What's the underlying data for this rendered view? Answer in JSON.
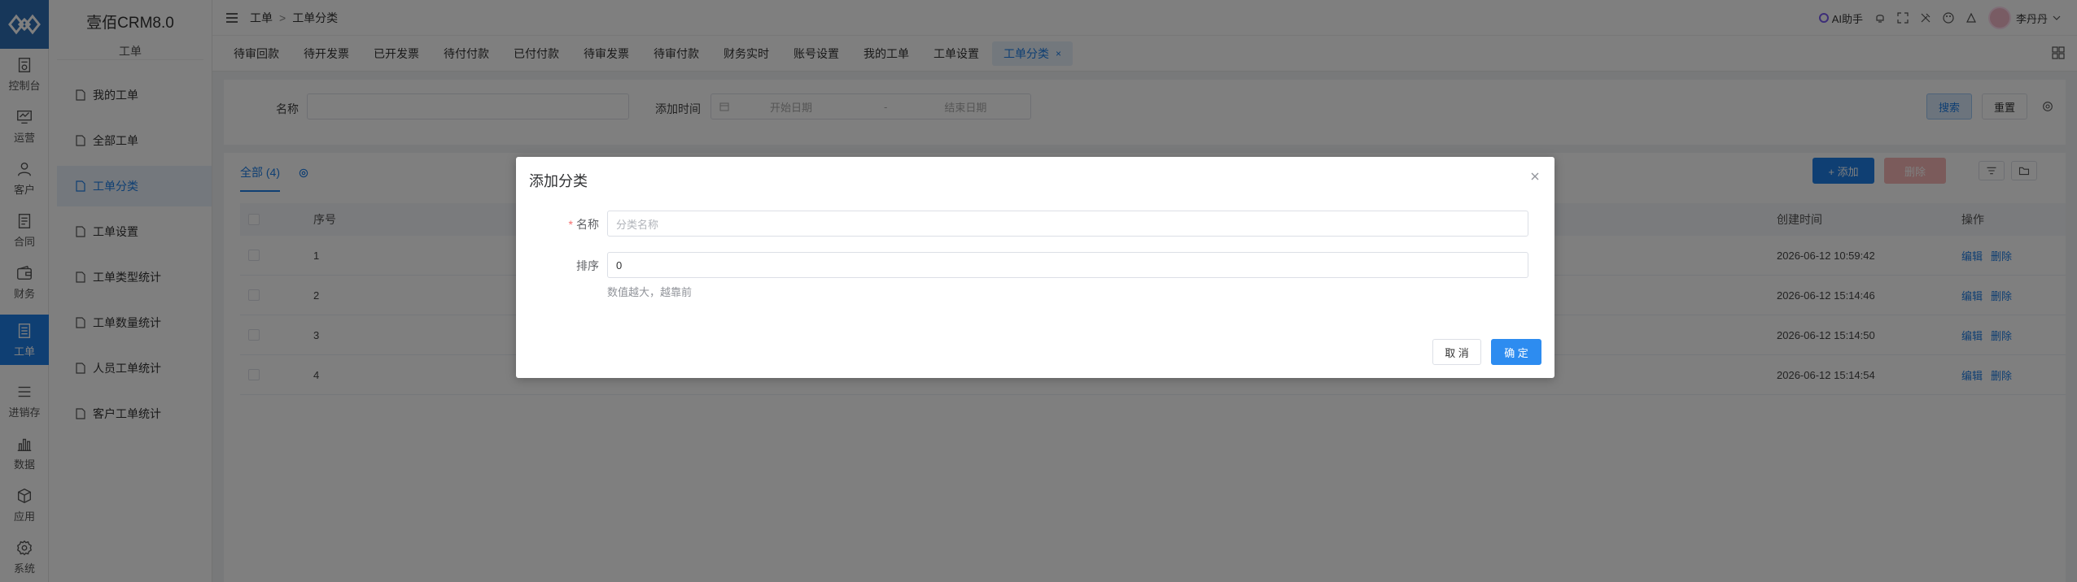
{
  "app": {
    "title": "壹佰CRM8.0",
    "module": "工单"
  },
  "rail": [
    {
      "label": "控制台",
      "icon": "dashboard-icon"
    },
    {
      "label": "运营",
      "icon": "monitor-chart-icon"
    },
    {
      "label": "客户",
      "icon": "user-icon"
    },
    {
      "label": "合同",
      "icon": "contract-icon"
    },
    {
      "label": "财务",
      "icon": "wallet-icon"
    },
    {
      "label": "工单",
      "icon": "ticket-icon"
    },
    {
      "label": "进销存",
      "icon": "list-icon"
    },
    {
      "label": "数据",
      "icon": "bar-chart-icon"
    },
    {
      "label": "应用",
      "icon": "cube-icon"
    },
    {
      "label": "系统",
      "icon": "settings-icon"
    }
  ],
  "submenu": {
    "items": [
      {
        "label": "我的工单"
      },
      {
        "label": "全部工单"
      },
      {
        "label": "工单分类"
      },
      {
        "label": "工单设置"
      },
      {
        "label": "工单类型统计"
      },
      {
        "label": "工单数量统计"
      },
      {
        "label": "人员工单统计"
      },
      {
        "label": "客户工单统计"
      }
    ]
  },
  "header": {
    "crumbs": [
      "工单",
      "工单分类"
    ],
    "crumb_sep": ">",
    "ai": "AI助手",
    "user": "李丹丹"
  },
  "tabs": [
    {
      "label": "待审回款"
    },
    {
      "label": "待开发票"
    },
    {
      "label": "已开发票"
    },
    {
      "label": "待付付款"
    },
    {
      "label": "已付付款"
    },
    {
      "label": "待审发票"
    },
    {
      "label": "待审付款"
    },
    {
      "label": "财务实时"
    },
    {
      "label": "账号设置"
    },
    {
      "label": "我的工单"
    },
    {
      "label": "工单设置"
    },
    {
      "label": "工单分类"
    }
  ],
  "tab_close": "×",
  "search": {
    "name_label": "名称",
    "time_label": "添加时间",
    "start_placeholder": "开始日期",
    "range_sep": "-",
    "end_placeholder": "结束日期",
    "search_btn": "搜索",
    "reset_btn": "重置"
  },
  "toolbar": {
    "all_tab": "全部 (4)",
    "add_btn": "+ 添加",
    "delete_btn": "删除"
  },
  "table": {
    "headers": {
      "seq": "序号",
      "created": "创建时间",
      "ops": "操作"
    },
    "rows": [
      {
        "seq": "1",
        "created": "2026-06-12 10:59:42"
      },
      {
        "seq": "2",
        "created": "2026-06-12 15:14:46"
      },
      {
        "seq": "3",
        "created": "2026-06-12 15:14:50"
      },
      {
        "seq": "4",
        "created": "2026-06-12 15:14:54"
      }
    ],
    "edit": "编辑",
    "del": "删除"
  },
  "dialog": {
    "title": "添加分类",
    "name_label": "名称",
    "required_mark": "*",
    "name_placeholder": "分类名称",
    "sort_label": "排序",
    "sort_value": "0",
    "sort_hint": "数值越大，越靠前",
    "cancel": "取 消",
    "ok": "确 定"
  },
  "colors": {
    "primary": "#1e7ee6",
    "danger": "#f56c6c",
    "logo": "#2f6fb5"
  }
}
